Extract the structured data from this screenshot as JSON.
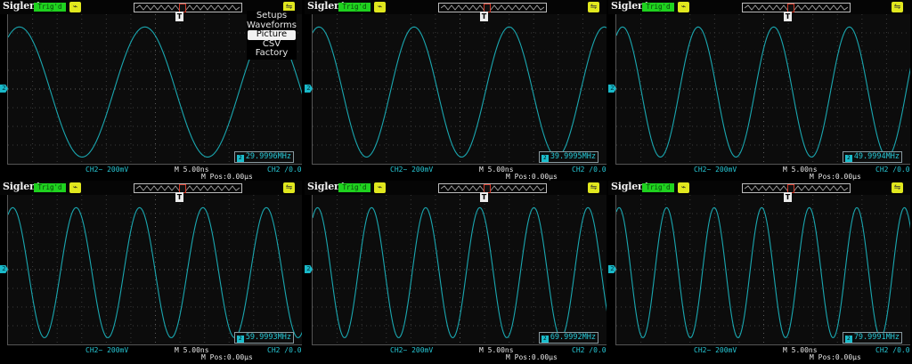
{
  "common": {
    "brand": "Siglent",
    "trig_status": "Trig'd",
    "trigger_marker": "T",
    "channel_marker": "2",
    "bottom_ch2": "CH2~ 200mV",
    "bottom_time": "M 5.00ns",
    "bottom_right": "CH2 /0.0",
    "bottom_mpos": "M Pos:0.00μs",
    "usb_icon": "usb-icon",
    "trigger_icon": "trigger-mode-icon",
    "wave_color": "#1aa7b0",
    "accent_cyan": "#27c8d6"
  },
  "menu": {
    "items": [
      "Setups",
      "Waveforms",
      "Picture",
      "CSV",
      "Factory"
    ],
    "selected": "Picture"
  },
  "panels": [
    {
      "frequency": "29.9996MHz",
      "cycles": 2.35,
      "phase": 1.0
    },
    {
      "frequency": "39.9995MHz",
      "cycles": 3.1,
      "phase": 1.15
    },
    {
      "frequency": "49.9994MHz",
      "cycles": 3.9,
      "phase": 1.05
    },
    {
      "frequency": "59.9993MHz",
      "cycles": 4.65,
      "phase": 1.1
    },
    {
      "frequency": "69.9992MHz",
      "cycles": 5.45,
      "phase": 1.0
    },
    {
      "frequency": "79.9991MHz",
      "cycles": 6.2,
      "phase": 1.2
    }
  ]
}
